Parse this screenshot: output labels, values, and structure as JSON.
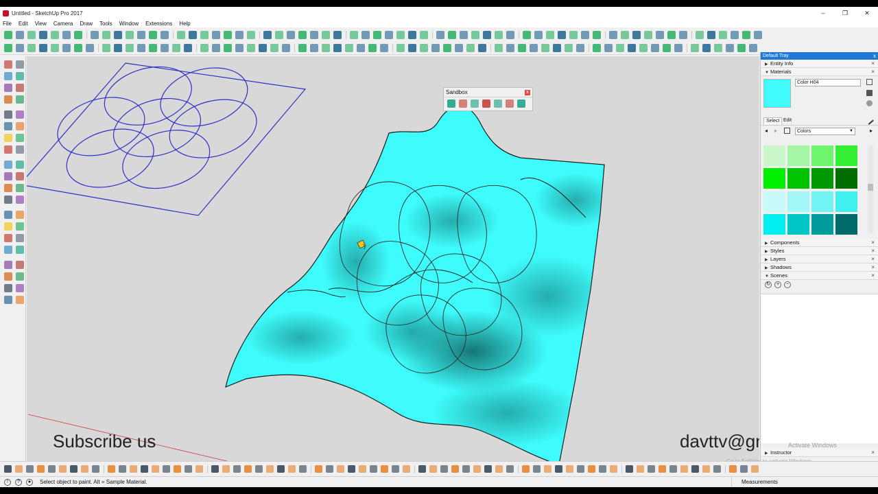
{
  "window": {
    "title": "Untitled - SketchUp Pro 2017",
    "minimize": "–",
    "maximize": "❐",
    "close": "✕"
  },
  "menu": [
    "File",
    "Edit",
    "View",
    "Camera",
    "Draw",
    "Tools",
    "Window",
    "Extensions",
    "Help"
  ],
  "sandbox": {
    "title": "Sandbox",
    "close": "x"
  },
  "tray": {
    "title": "Default Tray",
    "close": "x",
    "entity_info": "Entity Info",
    "materials": "Materials",
    "color_name": "Color H04",
    "tabs": [
      "Select",
      "Edit"
    ],
    "library": "Colors",
    "palette": [
      "#c9f7c9",
      "#a6f5a6",
      "#6df56d",
      "#33ee33",
      "#00f000",
      "#00c400",
      "#009900",
      "#006f00",
      "#c8fafa",
      "#a4f7f7",
      "#70f3f3",
      "#40efef",
      "#00f0f0",
      "#00c6c6",
      "#009b9b",
      "#006a6a"
    ],
    "panels": [
      "Components",
      "Styles",
      "Layers",
      "Shadows",
      "Scenes"
    ],
    "instructor": "Instructor",
    "activate_windows": "Activate Windows",
    "activate_sub": "Go to Settings to activate Windows"
  },
  "overlay": {
    "left_text": "Subscribe us",
    "right_text": "davttv@gmail.com"
  },
  "status": {
    "message": "Select object to paint. Alt = Sample Material.",
    "measurements": "Measurements"
  },
  "colors": {
    "surface": "#3ffcfc",
    "viewport_bg": "#d8d8d8",
    "blue_lines": "#2e2ec8",
    "accent_blue": "#1e78d4"
  }
}
